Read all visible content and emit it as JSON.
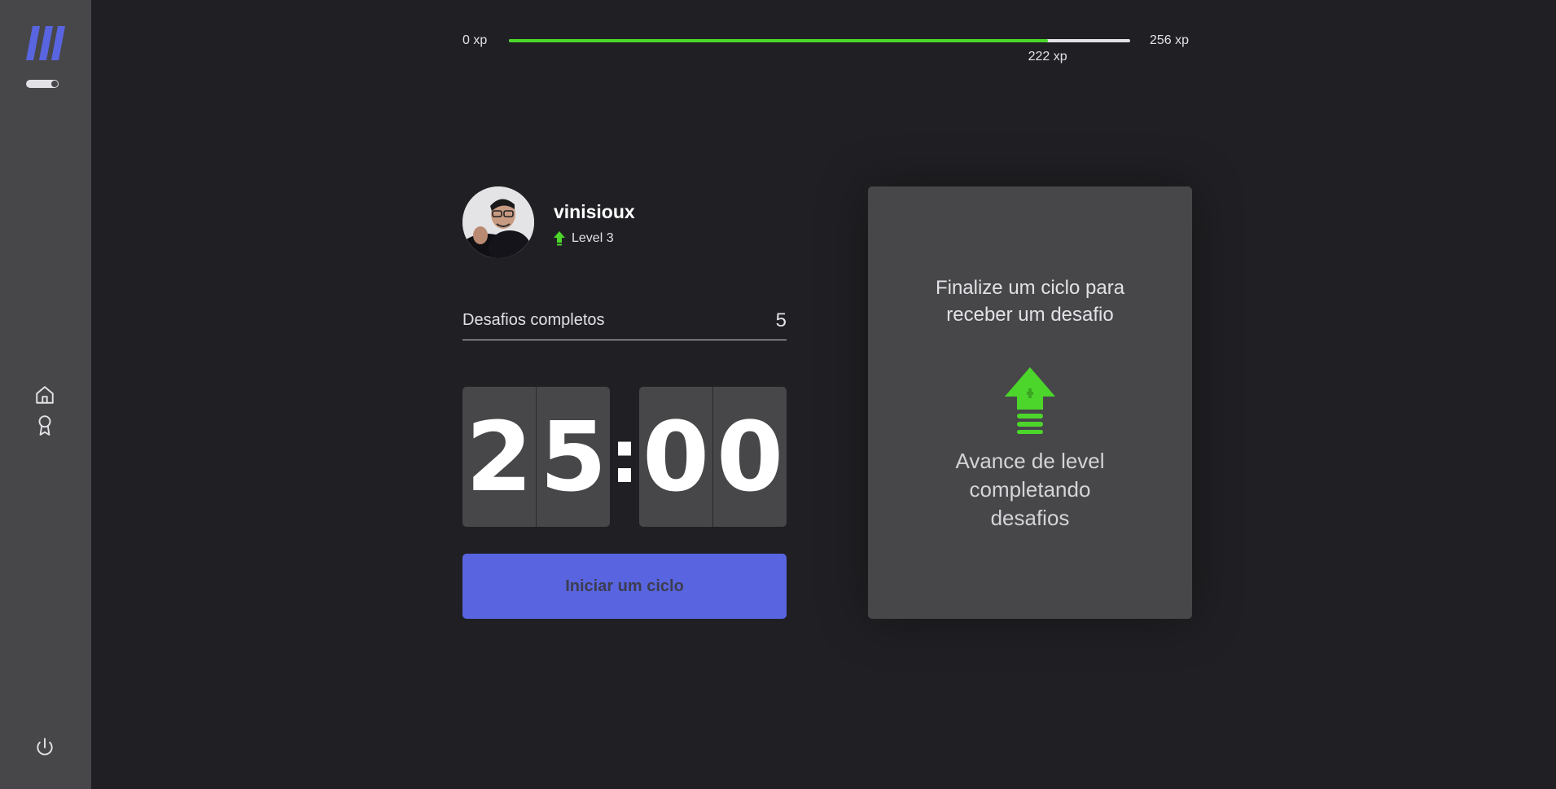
{
  "sidebar": {
    "logo_icon": "moveit-logo-icon",
    "nav": [
      {
        "name": "home",
        "icon": "home-icon"
      },
      {
        "name": "award",
        "icon": "award-icon"
      }
    ],
    "logout_icon": "power-icon"
  },
  "xp": {
    "min_label": "0 xp",
    "max_label": "256 xp",
    "current_label": "222 xp",
    "current": 222,
    "max": 256
  },
  "profile": {
    "username": "vinisioux",
    "level_label": "Level 3"
  },
  "challenges": {
    "label": "Desafios completos",
    "count": "5"
  },
  "countdown": {
    "minute_left": "2",
    "minute_right": "5",
    "separator": ":",
    "second_left": "0",
    "second_right": "0"
  },
  "start_button": {
    "label": "Iniciar um ciclo"
  },
  "challenge_box": {
    "title": "Finalize um ciclo para receber um desafio",
    "hint": "Avance de level completando desafios",
    "icon": "level-up-icon"
  },
  "colors": {
    "background": "#202024",
    "sidebar": "#47474a",
    "accent": "#5965e0",
    "green": "#4cd62b",
    "text": "#e1e1e6"
  }
}
